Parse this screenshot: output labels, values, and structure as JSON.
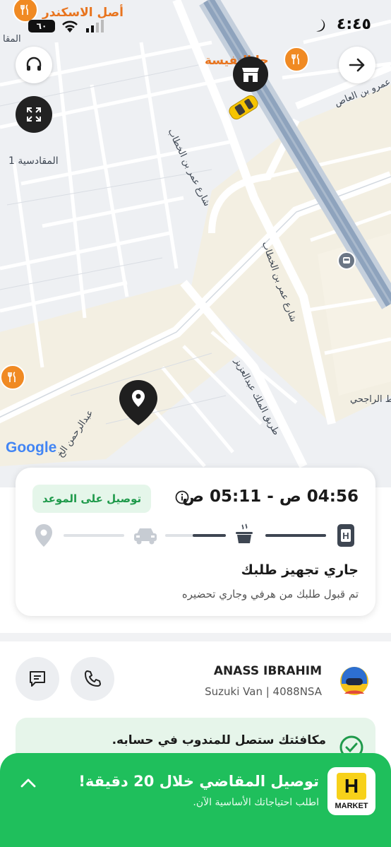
{
  "status_bar": {
    "time": "٤:٤٥",
    "battery": "٦٠"
  },
  "map": {
    "labels": {
      "top_left_poi": "أصل الاسكندر",
      "top_left_area": "المقا",
      "top_right_poi": "جا  النفيسة",
      "street_omar_top": "شارع عمر بن الخطاب",
      "street_amr": "شارع عمرو بن العاص",
      "area_maqadisa": "المقادسية 1",
      "street_omar_mid": "شارع عمر بن الخطاب",
      "street_king_abdulaziz": "طريق الملك عبدالعزيز",
      "street_abdulrahman": "عبدالرحمن الخ",
      "area_rajhi": "مخطط الراجحي",
      "google": "Google"
    }
  },
  "order_card": {
    "eta": "04:56 ص - 05:11 ص",
    "on_time_badge": "توصيل على الموعد",
    "status_title": "جاري تجهيز طلبك",
    "status_subtitle": "تم قبول طلبك من هرفي وجاري تحضيره",
    "progress": {
      "store_to_prep": 1.0,
      "prep_to_vehicle": 0.55,
      "vehicle_to_destination": 0.0
    }
  },
  "driver": {
    "name": "ANASS IBRAHIM",
    "vehicle": "Suzuki Van | 4088NSA"
  },
  "reward": {
    "text": "مكافئتك ستصل للمندوب في حسابه."
  },
  "promo": {
    "title": "توصيل المقاضي خلال 20 دقيقة!",
    "subtitle": "اطلب احتياجاتك الأساسية الآن.",
    "logo_letter": "H",
    "logo_word": "MARKET"
  },
  "colors": {
    "accent_green": "#1fbf5c",
    "badge_green": "#1f9a4b",
    "poi_orange": "#f08a23",
    "highway_blue": "#8ea3bd"
  }
}
